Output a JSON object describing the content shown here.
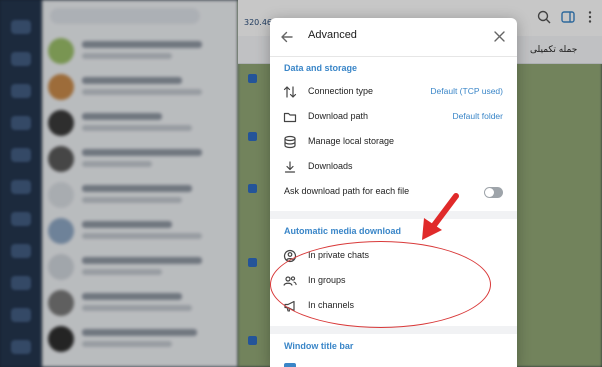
{
  "background": {
    "chat_header_text": "320.460",
    "chat_strip_text": "جمله تکمیلی"
  },
  "dialog": {
    "title": "Advanced",
    "back_icon": "arrow-left-icon",
    "close_icon": "close-icon",
    "data_storage": {
      "title": "Data and storage",
      "items": [
        {
          "icon": "swap-vertical-icon",
          "label": "Connection type",
          "value": "Default (TCP used)"
        },
        {
          "icon": "folder-icon",
          "label": "Download path",
          "value": "Default folder"
        },
        {
          "icon": "storage-icon",
          "label": "Manage local storage",
          "value": ""
        },
        {
          "icon": "download-icon",
          "label": "Downloads",
          "value": ""
        }
      ],
      "ask_toggle": {
        "label": "Ask download path for each file",
        "on": false
      }
    },
    "auto_media": {
      "title": "Automatic media download",
      "items": [
        {
          "icon": "user-circle-icon",
          "label": "In private chats"
        },
        {
          "icon": "users-icon",
          "label": "In groups"
        },
        {
          "icon": "megaphone-icon",
          "label": "In channels"
        }
      ]
    },
    "window_title_bar": {
      "title": "Window title bar"
    }
  },
  "colors": {
    "accent": "#3a86c8",
    "annotation": "#d93a3a"
  }
}
